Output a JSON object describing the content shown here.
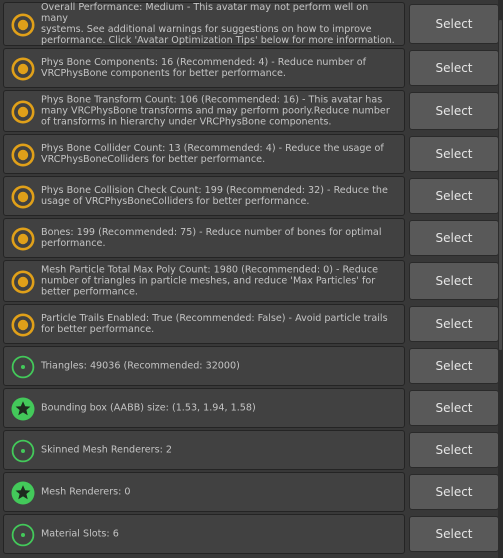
{
  "colors": {
    "background": "#383838",
    "message_box": "#414141",
    "button": "#595959",
    "warning_ring": "#e0a019",
    "good_green": "#43c95a",
    "text": "#c4c4c4"
  },
  "button_label": "Select",
  "items": [
    {
      "icon": "warning-icon",
      "text": "Overall Performance: Medium - This avatar may not perform well on many\nsystems. See additional warnings for suggestions on how to improve\nperformance. Click 'Avatar Optimization Tips' below for more information.",
      "button": "Select"
    },
    {
      "icon": "warning-icon",
      "text": "Phys Bone Components: 16 (Recommended: 4) - Reduce number of\nVRCPhysBone components for better performance.",
      "button": "Select"
    },
    {
      "icon": "warning-icon",
      "text": "Phys Bone Transform Count: 106 (Recommended: 16) - This avatar has\nmany VRCPhysBone transforms and may perform poorly.Reduce number\nof transforms in hierarchy under VRCPhysBone components.",
      "button": "Select"
    },
    {
      "icon": "warning-icon",
      "text": "Phys Bone Collider Count: 13 (Recommended: 4) - Reduce the usage of\nVRCPhysBoneColliders for better performance.",
      "button": "Select"
    },
    {
      "icon": "warning-icon",
      "text": "Phys Bone Collision Check Count: 199 (Recommended: 32) - Reduce the\nusage of VRCPhysBoneColliders for better performance.",
      "button": "Select"
    },
    {
      "icon": "warning-icon",
      "text": "Bones: 199 (Recommended: 75) - Reduce number of bones for optimal\nperformance.",
      "button": "Select"
    },
    {
      "icon": "warning-icon",
      "text": "Mesh Particle Total Max Poly Count: 1980 (Recommended: 0) - Reduce\nnumber of triangles in particle meshes, and reduce 'Max Particles' for\nbetter performance.",
      "button": "Select"
    },
    {
      "icon": "warning-icon",
      "text": "Particle Trails Enabled: True (Recommended: False) - Avoid particle trails\nfor better performance.",
      "button": "Select"
    },
    {
      "icon": "good-icon",
      "text": "Triangles: 49036 (Recommended: 32000)",
      "button": "Select"
    },
    {
      "icon": "excellent-star-icon",
      "text": "Bounding box (AABB) size: (1.53, 1.94, 1.58)",
      "button": "Select"
    },
    {
      "icon": "good-icon",
      "text": "Skinned Mesh Renderers: 2",
      "button": "Select"
    },
    {
      "icon": "excellent-star-icon",
      "text": "Mesh Renderers: 0",
      "button": "Select"
    },
    {
      "icon": "good-icon",
      "text": "Material Slots: 6",
      "button": "Select"
    }
  ]
}
